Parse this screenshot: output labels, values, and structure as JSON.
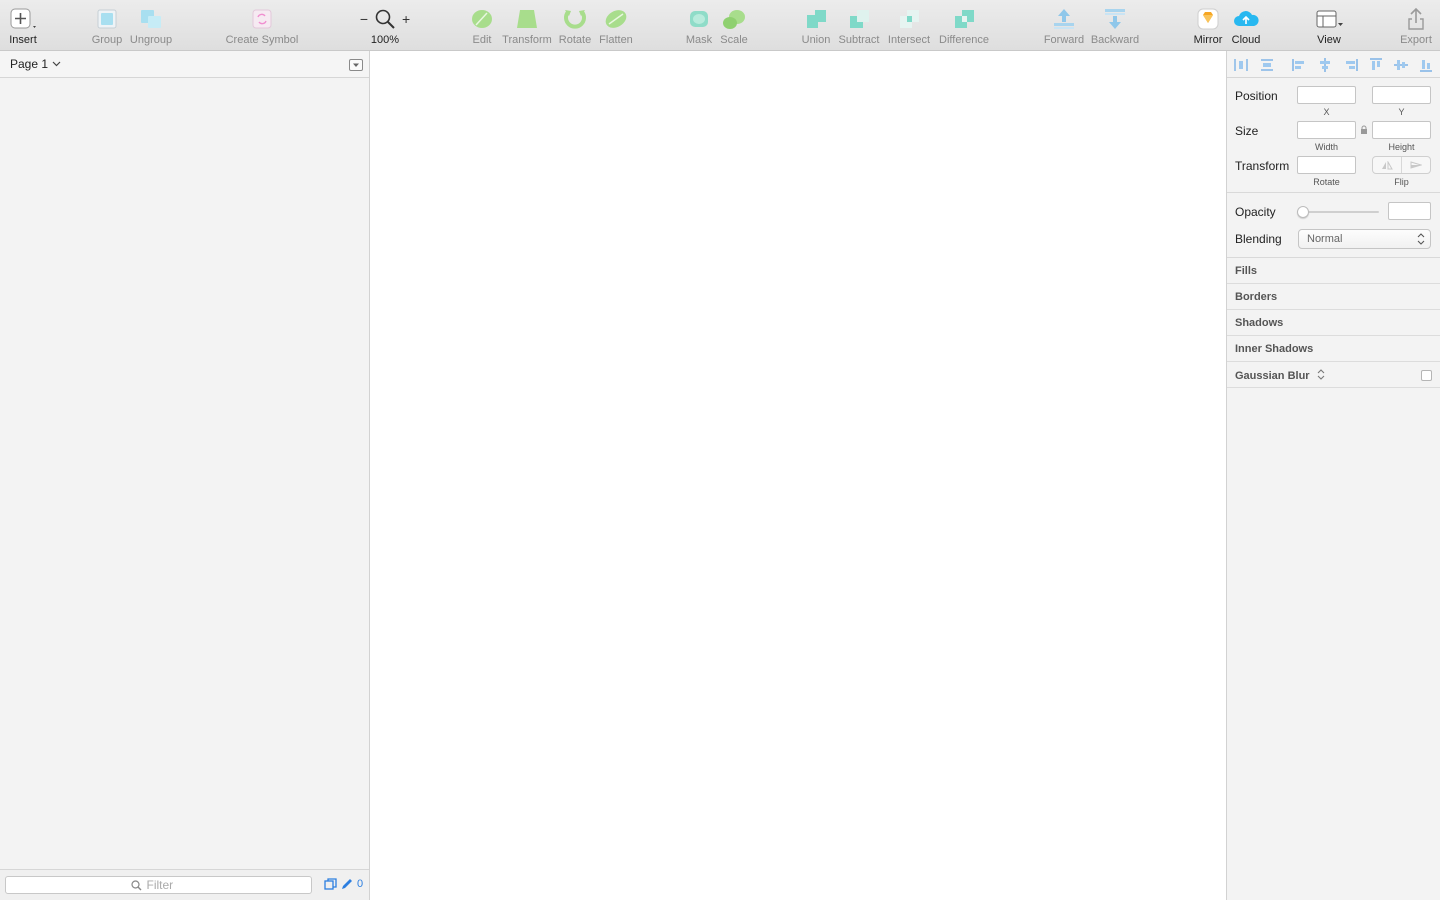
{
  "toolbar": {
    "insert": "Insert",
    "group": "Group",
    "ungroup": "Ungroup",
    "create_symbol": "Create Symbol",
    "zoom_minus": "−",
    "zoom_level": "100%",
    "zoom_plus": "+",
    "edit": "Edit",
    "transform": "Transform",
    "rotate": "Rotate",
    "flatten": "Flatten",
    "mask": "Mask",
    "scale": "Scale",
    "union": "Union",
    "subtract": "Subtract",
    "intersect": "Intersect",
    "difference": "Difference",
    "forward": "Forward",
    "backward": "Backward",
    "mirror": "Mirror",
    "cloud": "Cloud",
    "view": "View",
    "export": "Export"
  },
  "layers": {
    "page_selector": "Page 1",
    "filter_placeholder": "Filter",
    "edit_count": "0"
  },
  "inspector": {
    "position_label": "Position",
    "x_label": "X",
    "y_label": "Y",
    "size_label": "Size",
    "width_label": "Width",
    "height_label": "Height",
    "transform_label": "Transform",
    "rotate_label": "Rotate",
    "flip_label": "Flip",
    "opacity_label": "Opacity",
    "blending_label": "Blending",
    "blending_value": "Normal",
    "fills": "Fills",
    "borders": "Borders",
    "shadows": "Shadows",
    "inner_shadows": "Inner Shadows",
    "gaussian_blur": "Gaussian Blur"
  },
  "colors": {
    "accent_blue": "#2d7fe0",
    "teal": "#5fd8d0",
    "green": "#8fdc6c",
    "symbol_pink": "#f06bc6",
    "sketch_orange": "#f6a623"
  }
}
